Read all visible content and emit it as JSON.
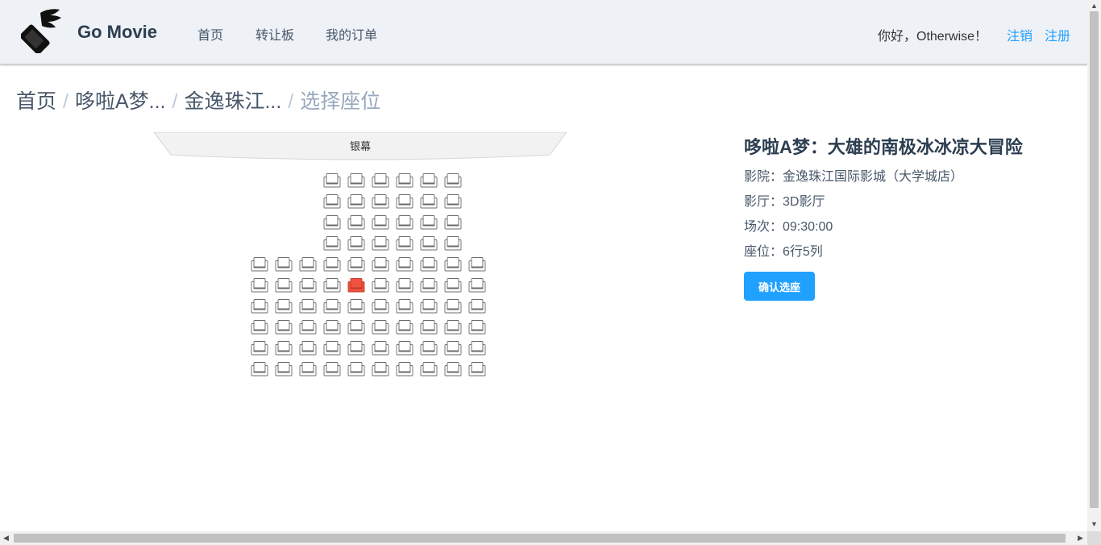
{
  "header": {
    "brand": "Go Movie",
    "logo_icon": "winged-phone-logo-icon",
    "nav": [
      {
        "label": "首页"
      },
      {
        "label": "转让板"
      },
      {
        "label": "我的订单"
      }
    ],
    "greeting": "你好，Otherwise！",
    "logout_label": "注销",
    "register_label": "注册"
  },
  "breadcrumb": {
    "items": [
      "首页",
      "哆啦A梦...",
      "金逸珠江..."
    ],
    "current": "选择座位",
    "separator": "/"
  },
  "screen": {
    "label": "银幕"
  },
  "seats": {
    "rows": [
      {
        "row": 1,
        "cols": [
          4,
          5,
          6,
          7,
          8,
          9
        ]
      },
      {
        "row": 2,
        "cols": [
          4,
          5,
          6,
          7,
          8,
          9
        ]
      },
      {
        "row": 3,
        "cols": [
          4,
          5,
          6,
          7,
          8,
          9
        ]
      },
      {
        "row": 4,
        "cols": [
          4,
          5,
          6,
          7,
          8,
          9
        ]
      },
      {
        "row": 5,
        "cols": [
          1,
          2,
          3,
          4,
          5,
          6,
          7,
          8,
          9,
          10
        ]
      },
      {
        "row": 6,
        "cols": [
          1,
          2,
          3,
          4,
          5,
          6,
          7,
          8,
          9,
          10
        ]
      },
      {
        "row": 7,
        "cols": [
          1,
          2,
          3,
          4,
          5,
          6,
          7,
          8,
          9,
          10
        ]
      },
      {
        "row": 8,
        "cols": [
          1,
          2,
          3,
          4,
          5,
          6,
          7,
          8,
          9,
          10
        ]
      },
      {
        "row": 9,
        "cols": [
          1,
          2,
          3,
          4,
          5,
          6,
          7,
          8,
          9,
          10
        ]
      },
      {
        "row": 10,
        "cols": [
          1,
          2,
          3,
          4,
          5,
          6,
          7,
          8,
          9,
          10
        ]
      }
    ],
    "selected": {
      "row": 6,
      "col": 5
    },
    "seat_icon": "seat-icon",
    "selected_color": "#f0533f",
    "empty_color": "#ffffff"
  },
  "info": {
    "movie_title": "哆啦A梦：大雄的南极冰冰凉大冒险",
    "cinema": "影院：金逸珠江国际影城（大学城店）",
    "hall": "影厅：3D影厅",
    "session": "场次：09:30:00",
    "seat": "座位：6行5列",
    "confirm_label": "确认选座"
  },
  "colors": {
    "accent": "#20a0ff",
    "navbar_bg": "#eef1f6",
    "title": "#2c3e50"
  }
}
